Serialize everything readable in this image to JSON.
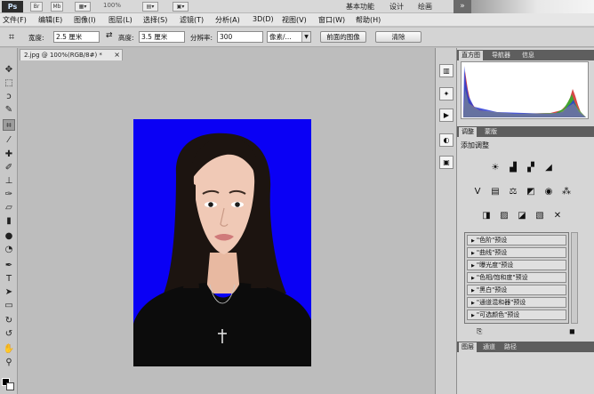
{
  "app": {
    "logo": "Ps",
    "toolbar_icons": [
      "Br",
      "Mb"
    ],
    "zoom": "100%",
    "workspace": [
      "基本功能",
      "设计",
      "绘画"
    ]
  },
  "menu": [
    "文件(F)",
    "编辑(E)",
    "图像(I)",
    "图层(L)",
    "选择(S)",
    "滤镜(T)",
    "分析(A)",
    "3D(D)",
    "视图(V)",
    "窗口(W)",
    "帮助(H)"
  ],
  "options": {
    "width_label": "宽度:",
    "width_value": "2.5 厘米",
    "height_label": "高度:",
    "height_value": "3.5 厘米",
    "resolution_label": "分辨率:",
    "resolution_value": "300",
    "unit_value": "像素/...",
    "front_image_button": "前面的图像",
    "clear_button": "清除"
  },
  "document": {
    "tab_title": "2.jpg @ 100%(RGB/8#) *",
    "close": "×"
  },
  "panels": {
    "top_tabs": [
      "直方图",
      "导航器",
      "信息"
    ],
    "adjust_tabs": [
      "调整",
      "蒙版"
    ],
    "adjust_title": "添加调整",
    "presets": [
      "\"色阶\"预设",
      "\"曲线\"预设",
      "\"曝光度\"预设",
      "\"色相/饱和度\"预设",
      "\"黑白\"预设",
      "\"通道混和器\"预设",
      "\"可选颜色\"预设"
    ],
    "bottom_tabs": [
      "图层",
      "通道",
      "路径"
    ]
  },
  "colors": {
    "photo_background": "#0a00f5",
    "foreground": "#000000",
    "background": "#ffffff"
  }
}
